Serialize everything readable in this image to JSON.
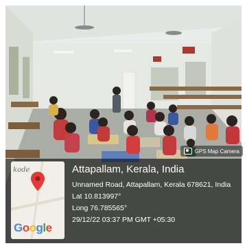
{
  "gps_tag": {
    "label": "GPS Map Camera",
    "icon": "camera-icon"
  },
  "location": {
    "title": "Attapallam, Kerala, India",
    "address": "Unnamed Road, Attapallam, Kerala 678621, India",
    "lat": "Lat 10.813997°",
    "long": "Long 76.785565°",
    "datetime": "29/12/22 03:37 PM GMT +05:30"
  },
  "map": {
    "place_label": "kode",
    "brand": [
      "G",
      "o",
      "o",
      "g",
      "l",
      "e"
    ],
    "pin_color": "#e53935"
  }
}
